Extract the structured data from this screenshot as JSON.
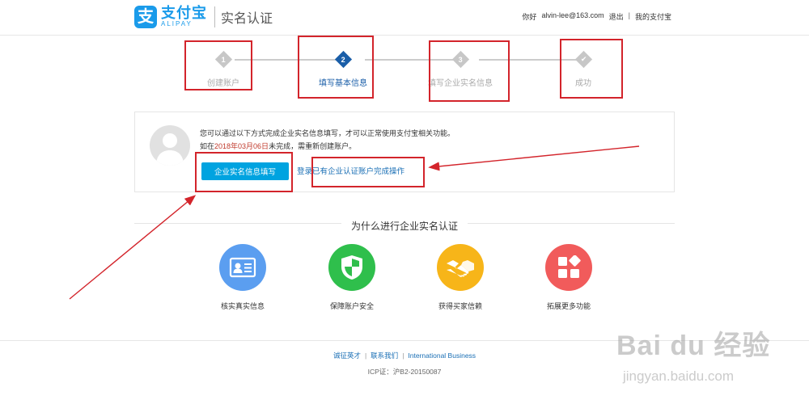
{
  "header": {
    "logo_mark": "支",
    "logo_cn": "支付宝",
    "logo_en": "ALIPAY",
    "page_title": "实名认证",
    "greeting": "你好",
    "user_email": "alvin-lee@163.com",
    "logout": "退出",
    "separator": "|",
    "my_alipay": "我的支付宝"
  },
  "steps": [
    {
      "number": "1",
      "label": "创建账户",
      "state": "done"
    },
    {
      "number": "2",
      "label": "填写基本信息",
      "state": "active"
    },
    {
      "number": "3",
      "label": "填写企业实名信息",
      "state": "todo"
    },
    {
      "number": "✔",
      "label": "成功",
      "state": "todo"
    }
  ],
  "card": {
    "line1": "您可以通过以下方式完成企业实名信息填写，才可以正常使用支付宝相关功能。",
    "line2_prefix": "如在",
    "deadline": "2018年03月06日",
    "line2_suffix": "未完成，需重新创建账户。",
    "primary_button": "企业实名信息填写",
    "login_link": "登录已有企业认证账户完成操作"
  },
  "why": {
    "title": "为什么进行企业实名认证",
    "features": [
      {
        "label": "核实真实信息",
        "icon": "id-card-icon",
        "color": "#5b9ef0"
      },
      {
        "label": "保障账户安全",
        "icon": "shield-icon",
        "color": "#2fbf4c"
      },
      {
        "label": "获得买家信赖",
        "icon": "handshake-icon",
        "color": "#f7b519"
      },
      {
        "label": "拓展更多功能",
        "icon": "blocks-icon",
        "color": "#f15b5b"
      }
    ]
  },
  "footer": {
    "link1": "诚征英才",
    "link2": "联系我们",
    "link3": "International Business",
    "separator": "|",
    "icp": "ICP证：沪B2-20150087"
  },
  "watermark": {
    "brand": "Bai du 经验",
    "url": "jingyan.baidu.com"
  },
  "colors": {
    "brand_blue": "#1a9bea",
    "step_active": "#1a5ea8",
    "primary_button": "#00a3e0",
    "annotation_red": "#d3242b",
    "deadline_red": "#c0392b"
  }
}
